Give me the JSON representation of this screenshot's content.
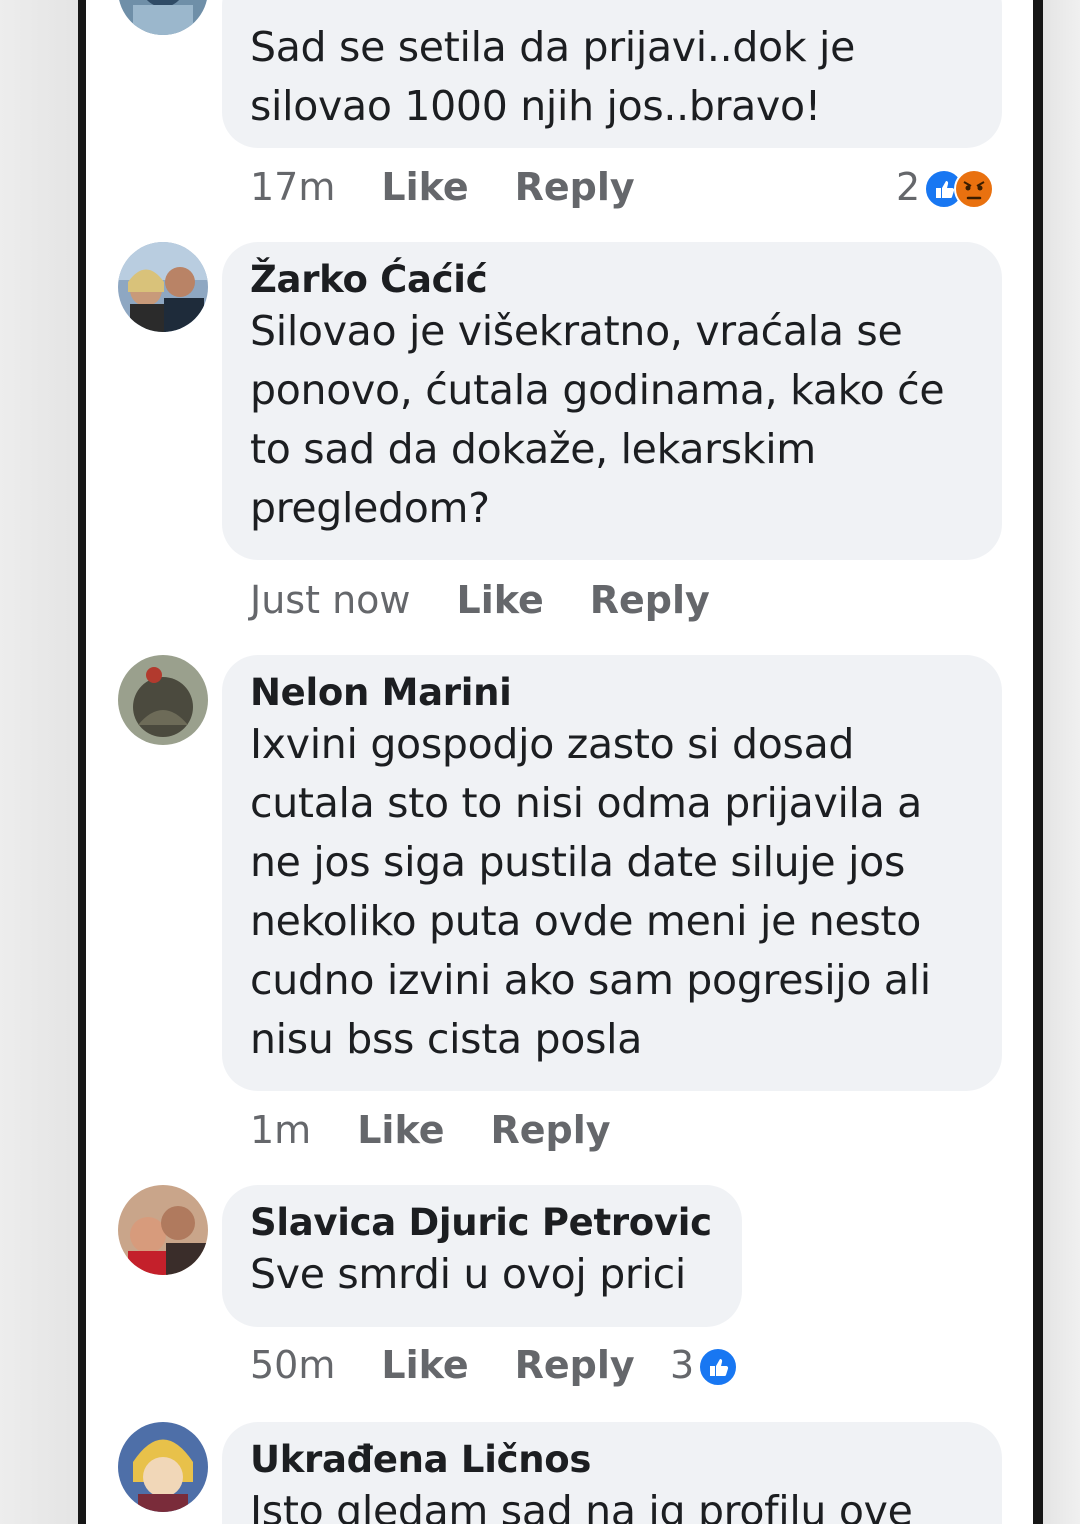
{
  "colors": {
    "bubble": "#f0f2f5",
    "meta_text": "#65676b",
    "like_blue": "#1877f2",
    "angry_orange": "#e9710f"
  },
  "comments": [
    {
      "author": "",
      "text": "Sad se setila da prijavi..dok je\nsilovao 1000 njih jos..bravo!",
      "time": "17m",
      "like": "Like",
      "reply": "Reply",
      "reaction_count": "2",
      "reactions": [
        "like-icon",
        "angry-icon"
      ]
    },
    {
      "author": "Žarko Ćaćić",
      "text": "Silovao je višekratno, vraćala se\nponovo, ćutala godinama, kako će\nto sad da dokaže, lekarskim\npregledom?",
      "time": "Just now",
      "like": "Like",
      "reply": "Reply"
    },
    {
      "author": "Nelon Marini",
      "text": "Ixvini gospodjo zasto si dosad\ncutala sto to nisi odma prijavila a\nne jos siga pustila date siluje jos\nnekoliko puta ovde meni je nesto\ncudno izvini ako sam pogresijo ali\nnisu bss cista posla",
      "time": "1m",
      "like": "Like",
      "reply": "Reply"
    },
    {
      "author": "Slavica Djuric Petrovic",
      "text": "Sve smrdi u ovoj prici",
      "time": "50m",
      "like": "Like",
      "reply": "Reply",
      "reaction_count": "3",
      "reactions": [
        "like-icon"
      ]
    },
    {
      "author": "Ukrađena Ličnos",
      "text": "Isto gledam sad na ig profilu ove"
    }
  ]
}
